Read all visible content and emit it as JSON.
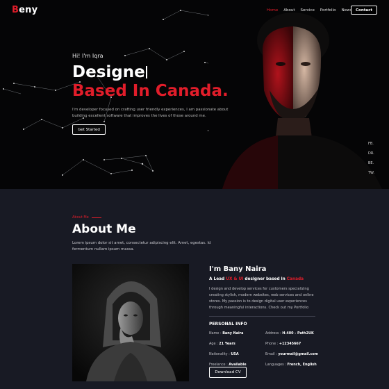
{
  "brand": {
    "logo_first": "B",
    "logo_rest": "eny",
    "accent": "#e11d2a"
  },
  "nav": {
    "items": [
      "Home",
      "About",
      "Service",
      "Portfolio",
      "News"
    ],
    "active": "Home",
    "contact": "Contact"
  },
  "hero": {
    "greeting": "Hi! I'm Iqra",
    "title_typed": "Designe",
    "title_red": "Based In Canada.",
    "description": "I'm developer focused on crafting user friendly experiences, I am passionate about building excellent software that improves the lives of those around me.",
    "cta": "Get Started"
  },
  "social": [
    "FB.",
    "DR.",
    "BE.",
    "TW."
  ],
  "about": {
    "tag": "About Me",
    "title": "About Me",
    "description": "Lorem ipsum dolor sit amet, consectetur adipiscing elit. Amet, egestas. Id fermentum nullam ipsum massa.",
    "name": "I'm Bany Naira",
    "role_prefix": "A Lead",
    "role_highlight": "UX & UI",
    "role_middle": "designer based in",
    "role_location": "Canada",
    "bio": "I design and develop services for customers specializing creating stylish, modern websites, web services and online stores. My passion is to design digital user experiences through meaningful interactions. Check out my Portfolio",
    "personal_title": "PERSONAL INFO",
    "fields": [
      {
        "label": "Name :",
        "value": "Bany Naira"
      },
      {
        "label": "Address :",
        "value": "H-400 - Path2UK"
      },
      {
        "label": "Age :",
        "value": "21 Years"
      },
      {
        "label": "Phone :",
        "value": "+12345667"
      },
      {
        "label": "Nationality :",
        "value": "USA"
      },
      {
        "label": "Email :",
        "value": "yourmail@gmail.com"
      },
      {
        "label": "Freelance :",
        "value": "Available"
      },
      {
        "label": "Languages :",
        "value": "French, English"
      }
    ],
    "cv_button": "Download CV"
  }
}
